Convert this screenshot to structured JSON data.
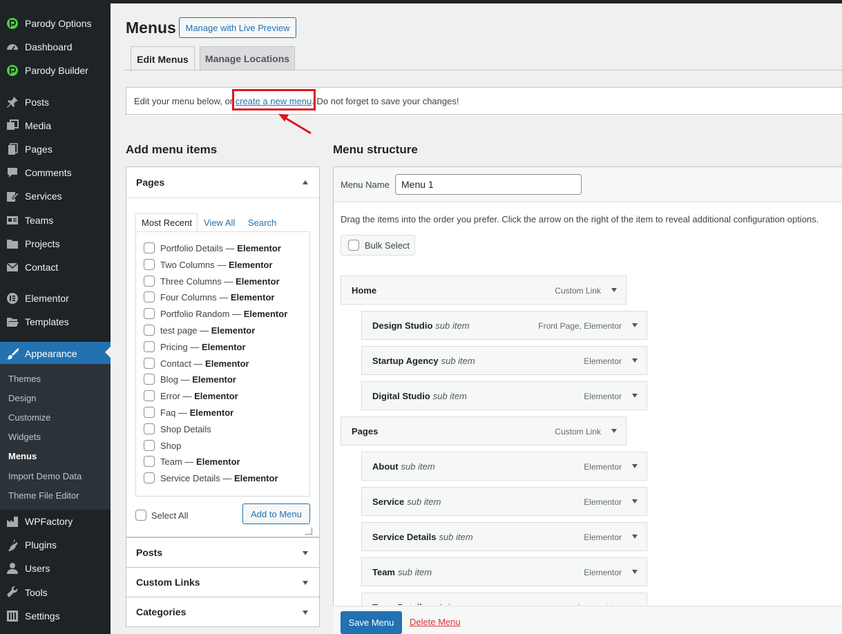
{
  "sidebar": {
    "items": [
      {
        "label": "Parody Options",
        "icon": "parody-logo-icon"
      },
      {
        "label": "Dashboard",
        "icon": "dashboard-icon"
      },
      {
        "label": "Parody Builder",
        "icon": "parody-logo-icon"
      },
      {
        "label": "Posts",
        "icon": "pin-icon"
      },
      {
        "label": "Media",
        "icon": "media-icon"
      },
      {
        "label": "Pages",
        "icon": "pages-icon"
      },
      {
        "label": "Comments",
        "icon": "comment-icon"
      },
      {
        "label": "Services",
        "icon": "edit-page-icon"
      },
      {
        "label": "Teams",
        "icon": "id-card-icon"
      },
      {
        "label": "Projects",
        "icon": "folder-icon"
      },
      {
        "label": "Contact",
        "icon": "envelope-icon"
      },
      {
        "label": "Elementor",
        "icon": "elementor-icon"
      },
      {
        "label": "Templates",
        "icon": "folder-open-icon"
      },
      {
        "label": "Appearance",
        "icon": "paintbrush-icon"
      },
      {
        "label": "WPFactory",
        "icon": "wpfactory-icon"
      },
      {
        "label": "Plugins",
        "icon": "plugin-icon"
      },
      {
        "label": "Users",
        "icon": "users-icon"
      },
      {
        "label": "Tools",
        "icon": "wrench-icon"
      },
      {
        "label": "Settings",
        "icon": "settings-icon"
      }
    ],
    "submenu": [
      "Themes",
      "Design",
      "Customize",
      "Widgets",
      "Menus",
      "Import Demo Data",
      "Theme File Editor"
    ]
  },
  "header": {
    "title": "Menus",
    "live_preview": "Manage with Live Preview",
    "tabs": [
      "Edit Menus",
      "Manage Locations"
    ]
  },
  "notice": {
    "before": "Edit your menu below, or ",
    "link": "create a new menu",
    "after": ". Do not forget to save your changes!"
  },
  "add_items": {
    "heading": "Add menu items",
    "pages_title": "Pages",
    "tabs": [
      "Most Recent",
      "View All",
      "Search"
    ],
    "pages": [
      {
        "name": "Portfolio Details",
        "suffix": "Elementor"
      },
      {
        "name": "Two Columns",
        "suffix": "Elementor"
      },
      {
        "name": "Three Columns",
        "suffix": "Elementor"
      },
      {
        "name": "Four Columns",
        "suffix": "Elementor"
      },
      {
        "name": "Portfolio Random",
        "suffix": "Elementor"
      },
      {
        "name": "test page",
        "suffix": "Elementor"
      },
      {
        "name": "Pricing",
        "suffix": "Elementor"
      },
      {
        "name": "Contact",
        "suffix": "Elementor"
      },
      {
        "name": "Blog",
        "suffix": "Elementor"
      },
      {
        "name": "Error",
        "suffix": "Elementor"
      },
      {
        "name": "Faq",
        "suffix": "Elementor"
      },
      {
        "name": "Shop Details",
        "suffix": ""
      },
      {
        "name": "Shop",
        "suffix": ""
      },
      {
        "name": "Team",
        "suffix": "Elementor"
      },
      {
        "name": "Service Details",
        "suffix": "Elementor"
      }
    ],
    "select_all": "Select All",
    "add_button": "Add to Menu",
    "sections": [
      "Posts",
      "Custom Links",
      "Categories"
    ]
  },
  "structure": {
    "heading": "Menu structure",
    "name_label": "Menu Name",
    "name_value": "Menu 1",
    "instructions": "Drag the items into the order you prefer. Click the arrow on the right of the item to reveal additional configuration options.",
    "bulk_select": "Bulk Select",
    "items": [
      {
        "title": "Home",
        "sub": "",
        "kind": "Custom Link",
        "depth": 0
      },
      {
        "title": "Design Studio",
        "sub": "sub item",
        "kind": "Front Page, Elementor",
        "depth": 1
      },
      {
        "title": "Startup Agency",
        "sub": "sub item",
        "kind": "Elementor",
        "depth": 1
      },
      {
        "title": "Digital Studio",
        "sub": "sub item",
        "kind": "Elementor",
        "depth": 1
      },
      {
        "title": "Pages",
        "sub": "",
        "kind": "Custom Link",
        "depth": 0
      },
      {
        "title": "About",
        "sub": "sub item",
        "kind": "Elementor",
        "depth": 1
      },
      {
        "title": "Service",
        "sub": "sub item",
        "kind": "Elementor",
        "depth": 1
      },
      {
        "title": "Service Details",
        "sub": "sub item",
        "kind": "Elementor",
        "depth": 1
      },
      {
        "title": "Team",
        "sub": "sub item",
        "kind": "Elementor",
        "depth": 1
      },
      {
        "title": "Team Details",
        "sub": "sub item",
        "kind": "Custom Link",
        "depth": 1
      }
    ],
    "save": "Save Menu",
    "delete": "Delete Menu"
  },
  "colors": {
    "accent": "#2271b1",
    "sidebar": "#1d2327",
    "highlight": "#e0141e",
    "delete": "#d63638"
  }
}
